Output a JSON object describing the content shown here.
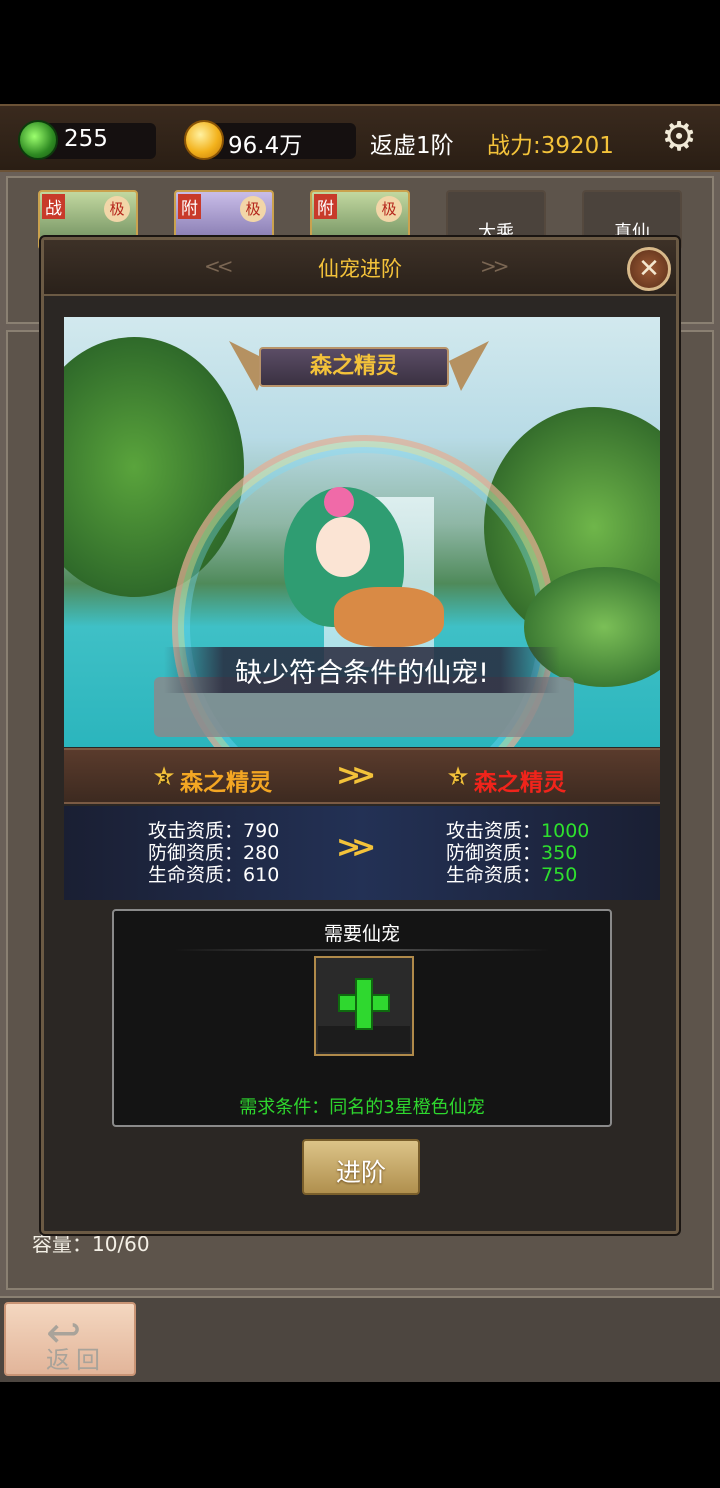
{
  "topbar": {
    "jade_value": "255",
    "gold_value": "96.4万",
    "realm": "返虚1阶",
    "power": "战力:39201",
    "colors": {
      "power": "#f3c23a"
    }
  },
  "background": {
    "tabs": [
      {
        "tag": "战",
        "badge": "极"
      },
      {
        "tag": "附",
        "badge": "极"
      },
      {
        "tag": "附",
        "badge": "极"
      },
      {
        "label": "大乘"
      },
      {
        "label": "真仙"
      }
    ],
    "capacity": "容量：10/60",
    "back_label": "返回"
  },
  "modal": {
    "title": "仙宠进阶",
    "pet_name": "森之精灵",
    "warning": "缺少符合条件的仙宠!",
    "current": {
      "stars": "3",
      "name": "森之精灵"
    },
    "next": {
      "stars": "3",
      "name": "森之精灵"
    },
    "stats_current": [
      {
        "label": "攻击资质：",
        "value": "790"
      },
      {
        "label": "防御资质：",
        "value": "280"
      },
      {
        "label": "生命资质：",
        "value": "610"
      }
    ],
    "stats_next": [
      {
        "label": "攻击资质：",
        "value": "1000"
      },
      {
        "label": "防御资质：",
        "value": "350"
      },
      {
        "label": "生命资质：",
        "value": "750"
      }
    ],
    "requirement": {
      "title": "需要仙宠",
      "condition": "需求条件：同名的3星橙色仙宠"
    },
    "advance_button": "进阶",
    "colors": {
      "title": "#f3c23a",
      "next_name": "#f0241b",
      "cur_name": "#f3a623",
      "stat_up": "#2ee02e"
    }
  }
}
